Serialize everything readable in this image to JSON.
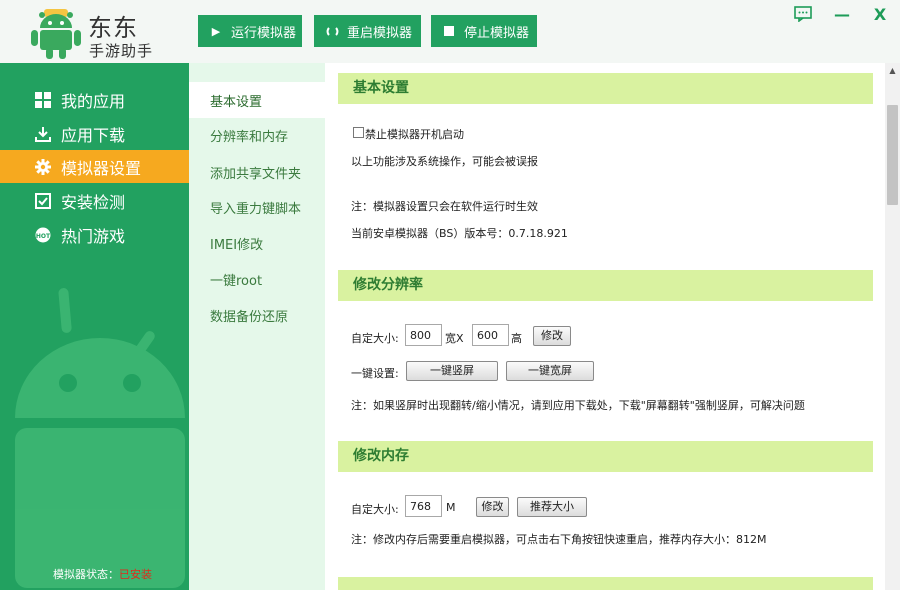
{
  "app": {
    "brand_line1": "东东",
    "brand_line2": "手游助手"
  },
  "toolbar": {
    "run_label": "运行模拟器",
    "restart_label": "重启模拟器",
    "stop_label": "停止模拟器"
  },
  "window": {
    "feedback_icon": "chat-icon",
    "minimize_icon": "minimize-icon",
    "close_icon": "close-icon",
    "minimize_glyph": "—",
    "close_glyph": "X"
  },
  "sidebar": {
    "items": [
      {
        "label": "我的应用",
        "icon": "grid-icon"
      },
      {
        "label": "应用下载",
        "icon": "download-icon"
      },
      {
        "label": "模拟器设置",
        "icon": "gear-icon",
        "active": true
      },
      {
        "label": "安装检测",
        "icon": "checkbox-icon"
      },
      {
        "label": "热门游戏",
        "icon": "hot-icon"
      }
    ],
    "status_label": "模拟器状态：",
    "status_value": "已安装"
  },
  "subnav": {
    "items": [
      {
        "label": "基本设置",
        "active": true
      },
      {
        "label": "分辨率和内存"
      },
      {
        "label": "添加共享文件夹"
      },
      {
        "label": "导入重力键脚本"
      },
      {
        "label": "IMEI修改"
      },
      {
        "label": "一键root"
      },
      {
        "label": "数据备份还原"
      }
    ]
  },
  "basic": {
    "title": "基本设置",
    "disable_boot_label": "禁止模拟器开机启动",
    "disable_boot_checked": false,
    "warning": "以上功能涉及系统操作，可能会被误报",
    "note": "注：模拟器设置只会在软件运行时生效",
    "version": "当前安卓模拟器（BS）版本号：0.7.18.921"
  },
  "resolution": {
    "title": "修改分辨率",
    "custom_label": "自定大小:",
    "width_value": "800",
    "width_unit": "宽X",
    "height_value": "600",
    "height_unit": "高",
    "modify_label": "修改",
    "onekey_label": "一键设置:",
    "portrait_label": "一键竖屏",
    "landscape_label": "一键宽屏",
    "note": "注：如果竖屏时出现翻转/缩小情况，请到应用下载处，下载\"屏幕翻转\"强制竖屏，可解决问题"
  },
  "memory": {
    "title": "修改内存",
    "custom_label": "自定大小:",
    "value": "768",
    "unit": "M",
    "modify_label": "修改",
    "recommend_label": "推荐大小",
    "note": "注：修改内存后需要重启模拟器，可点击右下角按钮快速重启，推荐内存大小：812M"
  },
  "colors": {
    "green": "#22a160",
    "orange": "#f6a91f",
    "section": "#d9f2a0",
    "subnav_bg": "#e5f8ea"
  }
}
